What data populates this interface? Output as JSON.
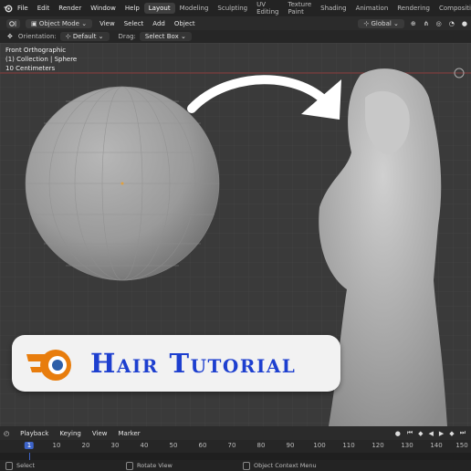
{
  "topbar": {
    "menus": [
      "File",
      "Edit",
      "Render",
      "Window",
      "Help"
    ],
    "workspaces": [
      "Layout",
      "Modeling",
      "Sculpting",
      "UV Editing",
      "Texture Paint",
      "Shading",
      "Animation",
      "Rendering",
      "Compositing"
    ],
    "active_workspace": "Layout"
  },
  "header": {
    "mode": "Object Mode",
    "menus": [
      "View",
      "Select",
      "Add",
      "Object"
    ],
    "transform_orientation": "Global"
  },
  "tool_header": {
    "orientation_label": "Orientation:",
    "orientation_value": "Default",
    "drag_label": "Drag:",
    "drag_value": "Select Box"
  },
  "viewport": {
    "view_name": "Front Orthographic",
    "collection": "(1) Collection | Sphere",
    "scale": "10 Centimeters"
  },
  "badge": {
    "title": "Hair Tutorial"
  },
  "timeline": {
    "menus": [
      "Playback",
      "Keying",
      "View",
      "Marker"
    ],
    "frame_numbers": [
      "1",
      "10",
      "20",
      "30",
      "40",
      "50",
      "60",
      "70",
      "80",
      "90",
      "100",
      "110",
      "120",
      "130",
      "140",
      "150"
    ],
    "current_frame": "1"
  },
  "statusbar": {
    "select": "Select",
    "rotate": "Rotate View",
    "context": "Object Context Menu"
  },
  "colors": {
    "accent": "#3d64c9",
    "badge_text": "#1d3fcf",
    "blender_orange": "#e87d0d"
  }
}
